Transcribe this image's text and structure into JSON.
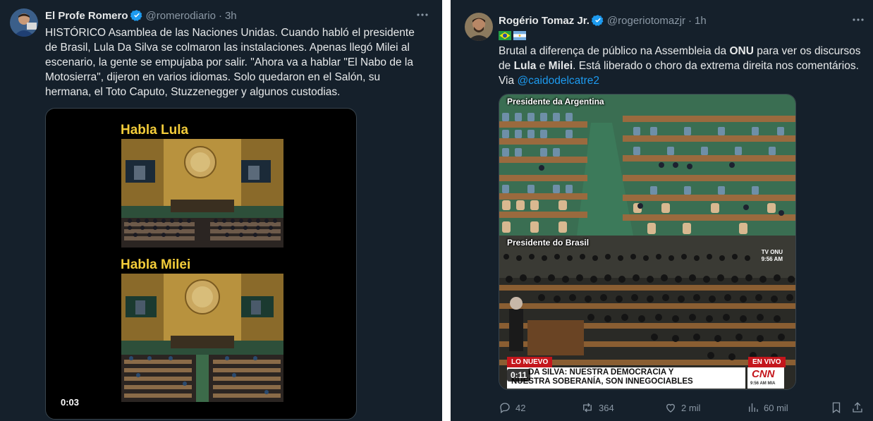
{
  "left_tweet": {
    "author_name": "El Profe Romero",
    "handle": "@romerodiario",
    "time": "3h",
    "text": "HISTÓRICO Asamblea de las Naciones Unidas. Cuando habló el presidente\nde Brasil, Lula Da Silva se colmaron las instalaciones. Apenas llegó Milei al\nescenario, la gente se empujaba por salir. \"Ahora va a hablar \"El Nabo de la\nMotosierra\", dijeron en varios idiomas. Solo quedaron en el Salón, su\nhermana, el Toto Caputo, Stuzzenegger y algunos custodias.",
    "video": {
      "caption_top": "Habla Lula",
      "caption_bottom": "Habla Milei",
      "timestamp": "0:03"
    }
  },
  "right_tweet": {
    "author_name": "Rogério Tomaz Jr.",
    "handle": "@rogeriotomazjr",
    "time": "1h",
    "flags": [
      "brazil-flag",
      "argentina-flag"
    ],
    "text_part1": "Brutal a diferença de público na Assembleia da ",
    "text_bold1": "ONU",
    "text_part2": " para ver os discursos\nde ",
    "text_bold2": "Lula",
    "text_part3": " e ",
    "text_bold3": "Milei",
    "text_part4": ". Está liberado o choro da extrema direita nos comentários.\nVia ",
    "mention": "@caidodelcatre2",
    "video": {
      "label_top": "Presidente da Argentina",
      "label_bottom": "Presidente do Brasil",
      "tv_badge_line1": "TV ONU",
      "tv_badge_line2": "9:56 AM",
      "lower_third_tag": "LO NUEVO",
      "lower_third_live": "EN VIVO",
      "lower_third_line1": "DA SILVA: NUESTRA DEMOCRACIA Y",
      "lower_third_line2": "NUESTRA SOBERANÍA, SON INNEGOCIABLES",
      "network": "CNN",
      "network_time": "9:56 AM MIA",
      "timestamp": "0:11"
    },
    "actions": {
      "replies": "42",
      "reposts": "364",
      "likes": "2 mil",
      "views": "60 mil"
    }
  }
}
